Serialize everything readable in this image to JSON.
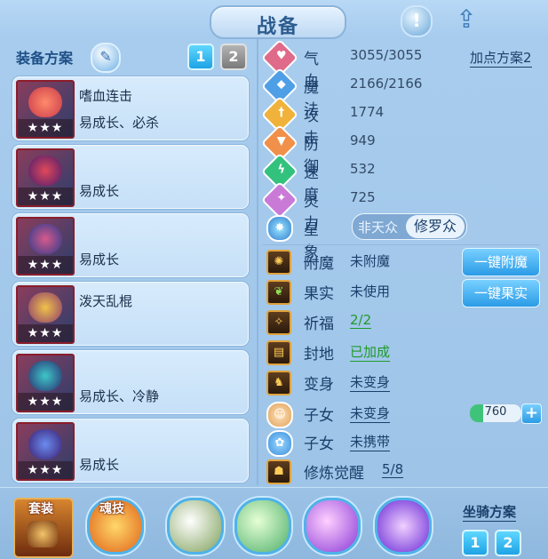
{
  "header": {
    "title": "战备",
    "info_icon": "exclamation-icon",
    "share_icon": "share-icon"
  },
  "equipment": {
    "label": "装备方案",
    "scheme_buttons": [
      {
        "label": "1",
        "active": true
      },
      {
        "label": "2",
        "active": false
      }
    ],
    "items": [
      {
        "name": "嗜血连击",
        "traits": "易成长、必杀",
        "stars": "★★★"
      },
      {
        "name": "",
        "traits": "易成长",
        "stars": "★★★"
      },
      {
        "name": "",
        "traits": "易成长",
        "stars": "★★★"
      },
      {
        "name": "泼天乱棍",
        "traits": "",
        "stars": "★★★"
      },
      {
        "name": "",
        "traits": "易成长、冷静",
        "stars": "★★★"
      },
      {
        "name": "",
        "traits": "易成长",
        "stars": "★★★"
      }
    ]
  },
  "stats": {
    "points_scheme_link": "加点方案2",
    "rows": [
      {
        "label": "气血",
        "value": "3055/3055",
        "icon": "heart-icon",
        "color": "#e06a8a"
      },
      {
        "label": "魔法",
        "value": "2166/2166",
        "icon": "mana-icon",
        "color": "#4f9fe6"
      },
      {
        "label": "攻击",
        "value": "1774",
        "icon": "sword-icon",
        "color": "#f0b23a"
      },
      {
        "label": "防御",
        "value": "949",
        "icon": "shield-icon",
        "color": "#f0904a"
      },
      {
        "label": "速度",
        "value": "532",
        "icon": "lightning-icon",
        "color": "#33c27d"
      },
      {
        "label": "灵力",
        "value": "725",
        "icon": "spirit-icon",
        "color": "#c97ad6"
      }
    ],
    "constellation": {
      "label": "星象",
      "option_a": "非天众",
      "option_b": "修罗众",
      "selected": "修罗众"
    }
  },
  "features": {
    "rows": [
      {
        "label": "附魔",
        "value": "未附魔",
        "icon": "enchant-icon"
      },
      {
        "label": "果实",
        "value": "未使用",
        "icon": "fruit-icon"
      },
      {
        "label": "祈福",
        "value": "2/2",
        "icon": "blessing-icon"
      },
      {
        "label": "封地",
        "value": "已加成",
        "icon": "fief-icon"
      },
      {
        "label": "变身",
        "value": "未变身",
        "icon": "transform-icon"
      },
      {
        "label": "子女",
        "value": "未变身",
        "icon": "child-icon"
      },
      {
        "label": "子女",
        "value": "未携带",
        "icon": "paw-icon"
      },
      {
        "label": "修炼觉醒",
        "value": "5/8",
        "icon": "cultivation-icon"
      }
    ],
    "enchant_button": "一键附魔",
    "fruit_button": "一键果实",
    "counter": {
      "value": "760",
      "fill_fraction": 0.25
    }
  },
  "bottom": {
    "suit_label": "套装",
    "soul_skill_label": "魂技",
    "mount_label": "坐骑方案",
    "mount_buttons": [
      {
        "label": "1",
        "active": false
      },
      {
        "label": "2",
        "active": true
      }
    ]
  }
}
